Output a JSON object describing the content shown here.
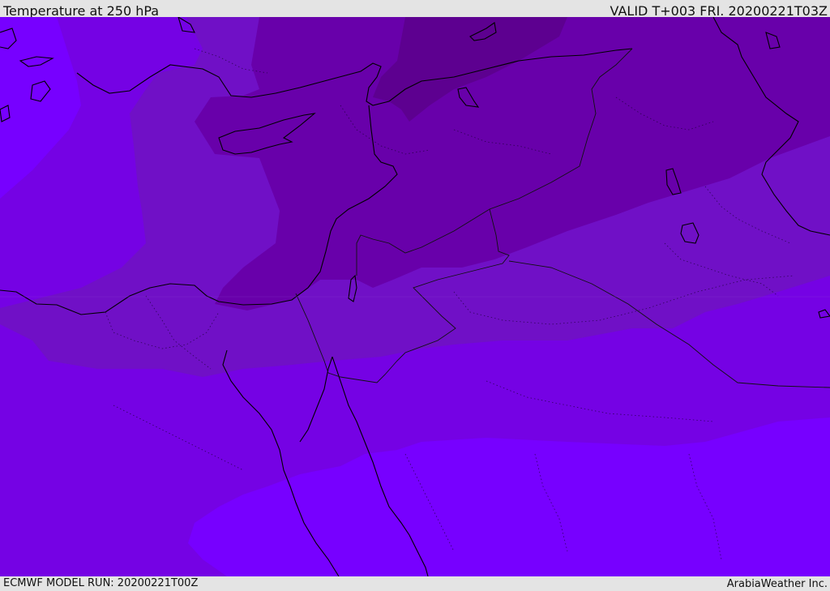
{
  "map": {
    "title": "Temperature at 250 hPa",
    "valid": "VALID T+003 FRI. 20200221T03Z",
    "model_run": "ECMWF MODEL RUN: 20200221T00Z",
    "credit": "ArabiaWeather Inc.",
    "colors": {
      "band_warmest": "#7700ff",
      "band_2": "#7502e4",
      "band_3": "#7010c6",
      "band_4": "#6800aa",
      "band_coldest": "#5d0090",
      "coastline": "#000000"
    }
  }
}
